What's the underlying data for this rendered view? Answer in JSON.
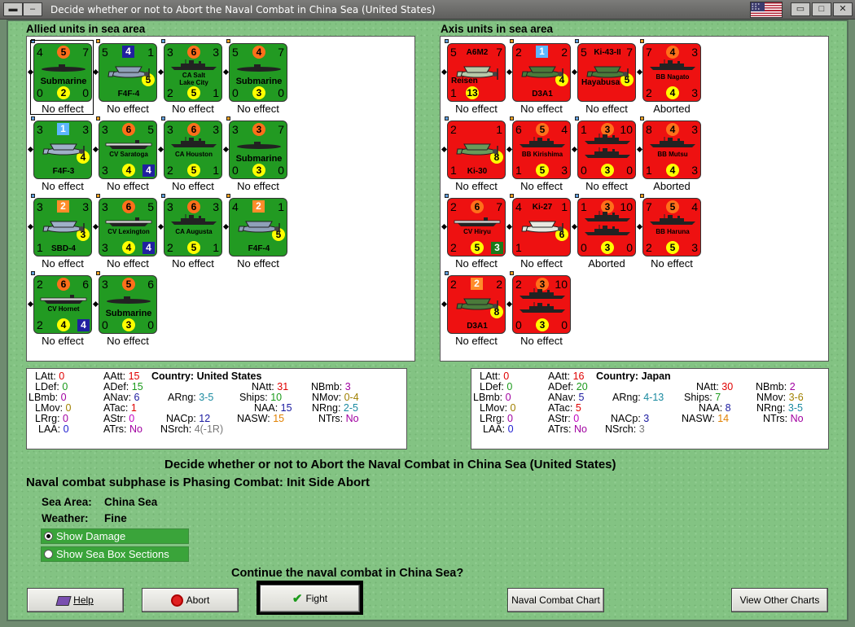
{
  "window_title": "Decide whether or not to Abort the Naval Combat in China Sea (United States)",
  "allied_title": "Allied units in sea area",
  "axis_title": "Axis units in sea area",
  "allied_units": [
    {
      "name": "Submarine",
      "tl": "4",
      "tc": "5",
      "tr": "7",
      "bl": "0",
      "bc": "2",
      "br": "0",
      "effect": "No effect"
    },
    {
      "name": "F4F-4",
      "tl": "5",
      "tc": "4",
      "tr": "1",
      "bc": "5",
      "effect": "No effect"
    },
    {
      "name": "CA Salt Lake City",
      "tl": "3",
      "tc": "6",
      "tr": "3",
      "bl": "2",
      "bc": "5",
      "br": "1",
      "effect": "No effect"
    },
    {
      "name": "Submarine",
      "tl": "5",
      "tc": "4",
      "tr": "7",
      "bl": "0",
      "bc": "3",
      "br": "0",
      "effect": "No effect"
    },
    {
      "name": "F4F-3",
      "tl": "3",
      "tc": "1",
      "tr": "3",
      "bc": "4",
      "effect": "No effect"
    },
    {
      "name": "CV Saratoga",
      "tl": "3",
      "tc": "6",
      "tr": "5",
      "bl": "3",
      "bc": "4",
      "br": "4",
      "effect": "No effect"
    },
    {
      "name": "CA Houston",
      "tl": "3",
      "tc": "6",
      "tr": "3",
      "bl": "2",
      "bc": "5",
      "br": "1",
      "effect": "No effect"
    },
    {
      "name": "Submarine",
      "tl": "3",
      "tc": "3",
      "tr": "7",
      "bl": "0",
      "bc": "3",
      "br": "0",
      "effect": "No effect"
    },
    {
      "name": "SBD-4",
      "tl": "3",
      "tc": "2",
      "tr": "3",
      "bl": "1",
      "bc": "3",
      "effect": "No effect"
    },
    {
      "name": "CV Lexington",
      "tl": "3",
      "tc": "6",
      "tr": "5",
      "bl": "3",
      "bc": "4",
      "br": "4",
      "effect": "No effect"
    },
    {
      "name": "CA Augusta",
      "tl": "3",
      "tc": "6",
      "tr": "3",
      "bl": "2",
      "bc": "5",
      "br": "1",
      "effect": "No effect"
    },
    {
      "name": "F4F-4",
      "tl": "4",
      "tc": "2",
      "tr": "1",
      "bc": "5",
      "effect": "No effect"
    },
    {
      "name": "CV Hornet",
      "tl": "2",
      "tc": "6",
      "tr": "6",
      "bl": "2",
      "bc": "4",
      "br": "4",
      "effect": "No effect"
    },
    {
      "name": "Submarine",
      "tl": "3",
      "tc": "5",
      "tr": "6",
      "bl": "0",
      "bc": "3",
      "br": "0",
      "effect": "No effect"
    }
  ],
  "axis_units": [
    {
      "name": "A6M2",
      "sub": "Reisen",
      "tl": "5",
      "tr": "7",
      "bl": "1",
      "bc": "13",
      "effect": "No effect"
    },
    {
      "name": "D3A1",
      "tl": "2",
      "tc": "1",
      "tr": "2",
      "bc": "4",
      "effect": "No effect"
    },
    {
      "name": "Ki-43-II",
      "sub": "Hayabusa",
      "tl": "5",
      "tr": "7",
      "bc": "5",
      "effect": "No effect"
    },
    {
      "name": "BB Nagato",
      "tl": "7",
      "tc": "4",
      "tr": "3",
      "bl": "2",
      "bc": "4",
      "br": "3",
      "effect": "Aborted"
    },
    {
      "name": "Ki-30",
      "tl": "2",
      "tr": "1",
      "bl": "1",
      "bc": "8",
      "effect": "No effect"
    },
    {
      "name": "BB Kirishima",
      "tl": "6",
      "tc": "5",
      "tr": "4",
      "bl": "1",
      "bc": "5",
      "br": "3",
      "effect": "No effect"
    },
    {
      "name": "",
      "tl": "1",
      "tc": "3",
      "tr": "10",
      "bl": "0",
      "bc": "3",
      "br": "0",
      "effect": "No effect"
    },
    {
      "name": "BB Mutsu",
      "tl": "8",
      "tc": "4",
      "tr": "3",
      "bl": "1",
      "bc": "4",
      "br": "3",
      "effect": "Aborted"
    },
    {
      "name": "CV Hiryu",
      "tl": "2",
      "tc": "6",
      "tr": "7",
      "bl": "2",
      "bc": "5",
      "br": "3",
      "effect": "No effect"
    },
    {
      "name": "Ki-27",
      "tl": "4",
      "tr": "1",
      "bl": "1",
      "bc": "6",
      "effect": "No effect"
    },
    {
      "name": "",
      "tl": "1",
      "tc": "3",
      "tr": "10",
      "bl": "0",
      "bc": "3",
      "br": "0",
      "effect": "Aborted"
    },
    {
      "name": "BB Haruna",
      "tl": "7",
      "tc": "5",
      "tr": "4",
      "bl": "2",
      "bc": "5",
      "br": "3",
      "effect": "No effect"
    },
    {
      "name": "D3A1",
      "tl": "2",
      "tc": "2",
      "tr": "2",
      "bc": "8",
      "effect": "No effect"
    },
    {
      "name": "",
      "tl": "2",
      "tc": "3",
      "tr": "10",
      "bl": "0",
      "bc": "3",
      "br": "0",
      "effect": "No effect"
    }
  ],
  "allied_stats": {
    "LAtt": "0",
    "LDef": "0",
    "LBmb": "0",
    "LMov": "0",
    "LRrg": "0",
    "LAA": "0",
    "AAtt": "15",
    "ADef": "15",
    "ANav": "6",
    "ATac": "1",
    "AStr": "0",
    "ATrs": "No",
    "country_label": "Country:",
    "country": "United States",
    "ARng": "3-5",
    "NACp": "12",
    "NSrch": "4(-1R)",
    "NAtt": "31",
    "Ships": "10",
    "NAA": "15",
    "NASW": "15",
    "NBmb": "3",
    "NMov": "0-4",
    "NRng": "2-5",
    "NTrs": "No"
  },
  "axis_stats": {
    "LAtt": "0",
    "LDef": "0",
    "LBmb": "0",
    "LMov": "0",
    "LRrg": "0",
    "LAA": "0",
    "AAtt": "16",
    "ADef": "20",
    "ANav": "5",
    "ATac": "5",
    "AStr": "0",
    "ATrs": "No",
    "country_label": "Country:",
    "country": "Japan",
    "ARng": "4-13",
    "NACp": "3",
    "NSrch": "3",
    "NAtt": "30",
    "Ships": "7",
    "NAA": "8",
    "NASW": "14",
    "NBmb": "2",
    "NMov": "3-6",
    "NRng": "3-5",
    "NTrs": "No"
  },
  "heading": "Decide whether or not to Abort the Naval Combat in China Sea (United States)",
  "subphase": "Naval combat subphase is Phasing Combat: Init Side Abort",
  "sea_area_label": "Sea Area:",
  "sea_area": "China Sea",
  "weather_label": "Weather:",
  "weather": "Fine",
  "show_damage": "Show Damage",
  "show_sea_box": "Show Sea Box Sections",
  "question": "Continue the naval combat in China Sea?",
  "buttons": {
    "help": "Help",
    "abort": "Abort",
    "fight": "Fight",
    "naval_chart": "Naval Combat Chart",
    "view_charts": "View Other Charts"
  },
  "colors": {
    "allied": "#229a22",
    "axis": "#ee1111",
    "bg": "#83c383"
  }
}
